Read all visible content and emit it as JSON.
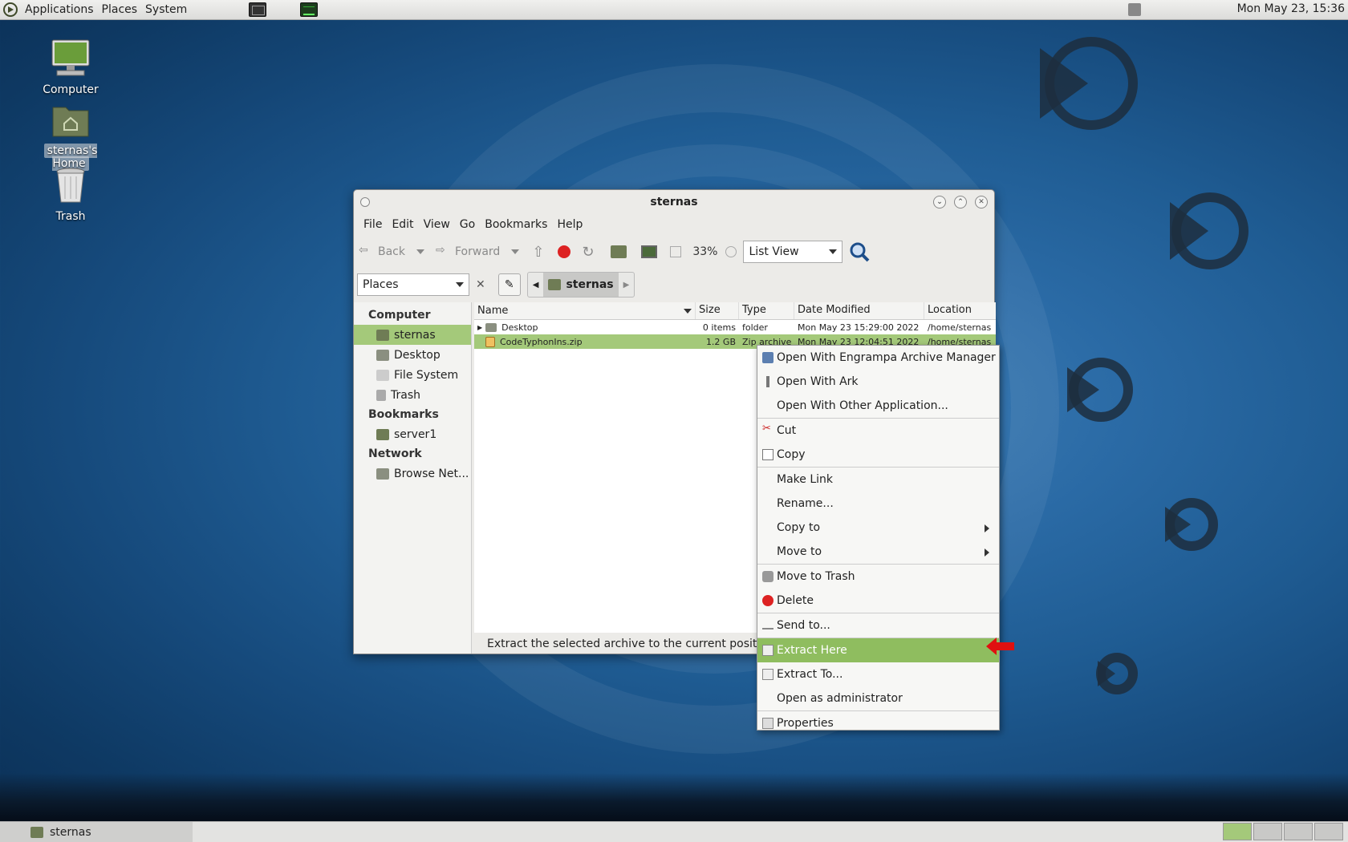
{
  "top_panel": {
    "menus": [
      "Applications",
      "Places",
      "System"
    ],
    "clock": "Mon May 23, 15:36"
  },
  "desktop": {
    "icons": [
      {
        "label": "Computer",
        "icon": "computer-icon"
      },
      {
        "label": "sternas's Home",
        "icon": "home-folder-icon"
      },
      {
        "label": "Trash",
        "icon": "trash-icon"
      }
    ]
  },
  "window": {
    "title": "sternas",
    "menu": [
      "File",
      "Edit",
      "View",
      "Go",
      "Bookmarks",
      "Help"
    ],
    "toolbar": {
      "back": "Back",
      "forward": "Forward",
      "zoom": "33%",
      "view_mode": "List View"
    },
    "places_combo": "Places",
    "breadcrumb": "sternas",
    "sidebar": {
      "sections": [
        {
          "header": "Computer",
          "items": [
            "sternas",
            "Desktop",
            "File System",
            "Trash"
          ]
        },
        {
          "header": "Bookmarks",
          "items": [
            "server1"
          ]
        },
        {
          "header": "Network",
          "items": [
            "Browse Net..."
          ]
        }
      ],
      "selected": "sternas"
    },
    "columns": [
      "Name",
      "Size",
      "Type",
      "Date Modified",
      "Location"
    ],
    "rows": [
      {
        "name": "Desktop",
        "size": "0 items",
        "type": "folder",
        "date": "Mon May 23 15:29:00 2022",
        "location": "/home/sternas"
      },
      {
        "name": "CodeTyphonIns.zip",
        "size": "1.2 GB",
        "type": "Zip archive",
        "date": "Mon May 23 12:04:51 2022",
        "location": "/home/sternas"
      }
    ],
    "status": "Extract the selected archive to the current position"
  },
  "context_menu": {
    "items": [
      {
        "label": "Open With Engrampa Archive Manager",
        "icon": "archive-manager-icon"
      },
      {
        "label": "Open With Ark",
        "icon": "ark-icon"
      },
      {
        "label": "Open With Other Application..."
      },
      {
        "label": "Cut",
        "icon": "scissors-icon"
      },
      {
        "label": "Copy",
        "icon": "copy-icon"
      },
      {
        "label": "Make Link"
      },
      {
        "label": "Rename..."
      },
      {
        "label": "Copy to"
      },
      {
        "label": "Move to"
      },
      {
        "label": "Move to Trash",
        "icon": "trash-icon"
      },
      {
        "label": "Delete",
        "icon": "delete-icon"
      },
      {
        "label": "Send to...",
        "icon": "send-icon"
      },
      {
        "label": "Extract Here",
        "icon": "extract-icon"
      },
      {
        "label": "Extract To...",
        "icon": "extract-icon"
      },
      {
        "label": "Open as administrator"
      },
      {
        "label": "Properties",
        "icon": "properties-icon"
      }
    ],
    "highlighted": "Extract Here"
  },
  "taskbar": {
    "task": "sternas"
  },
  "colors": {
    "selection": "#a4c97a",
    "menu_highlight": "#8fbd5f",
    "annotation_arrow": "#e01010"
  }
}
